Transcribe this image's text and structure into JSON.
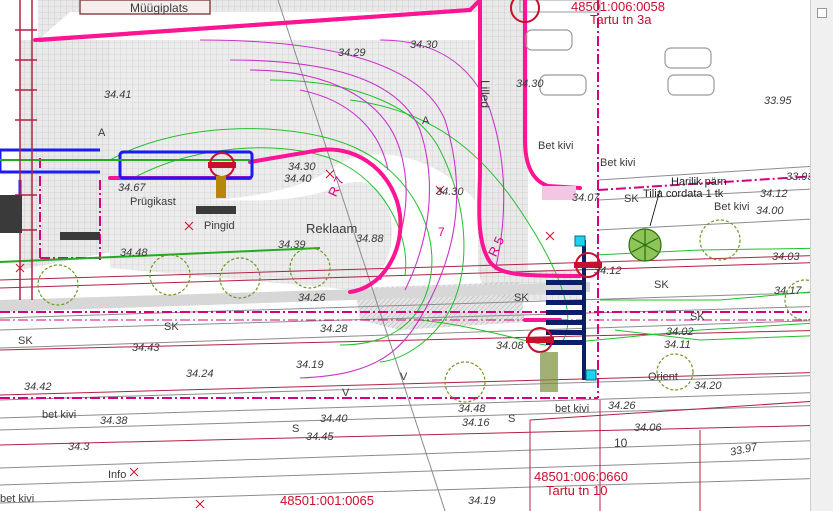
{
  "map": {
    "parcels": [
      {
        "id": "48501:006:0058",
        "address": "Tartu tn 3a"
      },
      {
        "id": "48501:006:0660",
        "address": "Tartu tn 10"
      },
      {
        "id": "48501:001:0065"
      }
    ],
    "street_labels": [
      "Müügiplats",
      "Lilled",
      "Prügikast",
      "Pingid",
      "Reklaam",
      "Info",
      "Orient"
    ],
    "surface_labels": [
      "Bet kivi",
      "Bet kivi",
      "bet kivi",
      "bet kivi",
      "bet kivi",
      "Bet kivi"
    ],
    "tree_note": {
      "line1": "Harilik pärn",
      "line2": "Tilia cordata 1 tk"
    },
    "curb_radii": [
      "R 7",
      "R 5"
    ],
    "number_marker": "7",
    "elevations": [
      "34.30",
      "34.29",
      "34.41",
      "34.30",
      "33.95",
      "34.30",
      "34.40",
      "34.67",
      "34.30",
      "34.07",
      "34.12",
      "33.93",
      "34.00",
      "34.48",
      "34.39",
      "34.88",
      "34.03",
      "34.12",
      "34.17",
      "34.26",
      "34.28",
      "34.43",
      "34.08",
      "34.02",
      "34.11",
      "34.42",
      "34.24",
      "34.19",
      "34.20",
      "34.38",
      "34.40",
      "34.45",
      "34.48",
      "34.16",
      "34.26",
      "34.06",
      "33.97",
      "34.3",
      "34.19"
    ],
    "small_labels": [
      "SK",
      "SK",
      "SK",
      "SK",
      "SK",
      "SK",
      "A",
      "A",
      "S",
      "S",
      "V",
      "V",
      "10"
    ]
  },
  "colors": {
    "parcel_boundary": "#d6007e",
    "curb": "#ff1493",
    "contour_green": "#22c02a",
    "contour_magenta": "#cc33cc",
    "utility_blue": "#1a1aff",
    "paving": "#c8c8c8",
    "crosswalk": "#0a1f66",
    "tree": "#6b9a1e"
  }
}
